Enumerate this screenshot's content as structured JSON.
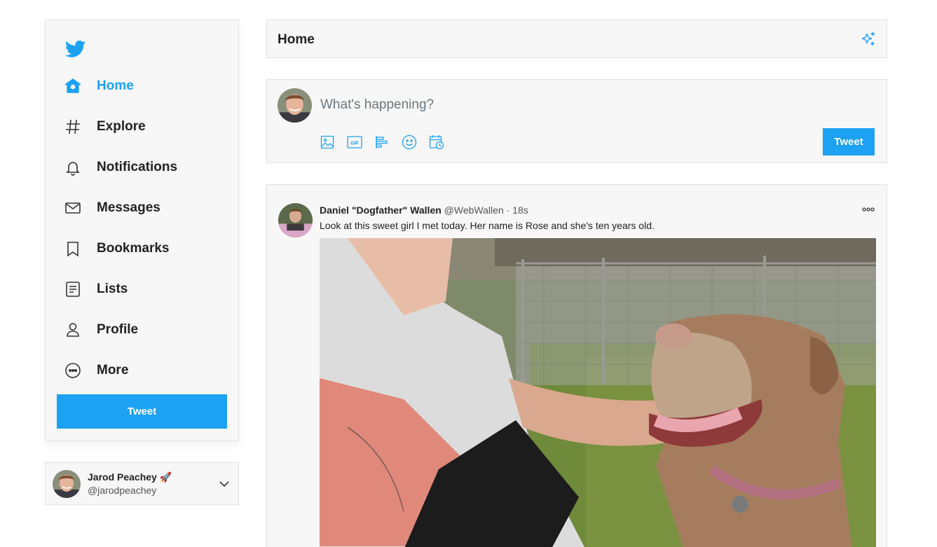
{
  "sidebar": {
    "logo_icon": "twitter-bird-icon",
    "items": [
      {
        "label": "Home",
        "icon": "home-icon",
        "active": true
      },
      {
        "label": "Explore",
        "icon": "hash-icon"
      },
      {
        "label": "Notifications",
        "icon": "bell-icon"
      },
      {
        "label": "Messages",
        "icon": "mail-icon"
      },
      {
        "label": "Bookmarks",
        "icon": "bookmark-icon"
      },
      {
        "label": "Lists",
        "icon": "list-icon"
      },
      {
        "label": "Profile",
        "icon": "user-icon"
      },
      {
        "label": "More",
        "icon": "more-circle-icon"
      }
    ],
    "tweet_button": "Tweet"
  },
  "account": {
    "name": "Jarod Peachey 🚀",
    "handle": "@jarodpeachey"
  },
  "header": {
    "title": "Home"
  },
  "composer": {
    "placeholder": "What's happening?",
    "tools": [
      "image-icon",
      "gif-icon",
      "poll-icon",
      "emoji-icon",
      "schedule-icon"
    ],
    "gif_text": "GIF",
    "tweet_button": "Tweet"
  },
  "tweet": {
    "name": "Daniel \"Dogfather\" Wallen",
    "handle": "@WebWallen",
    "separator": "·",
    "time": "18s",
    "text": "Look at this sweet girl I met today. Her name is Rose and she's ten years old."
  },
  "colors": {
    "accent": "#1da1f2",
    "panel": "#f7f7f7",
    "border": "#e1e1e1"
  }
}
